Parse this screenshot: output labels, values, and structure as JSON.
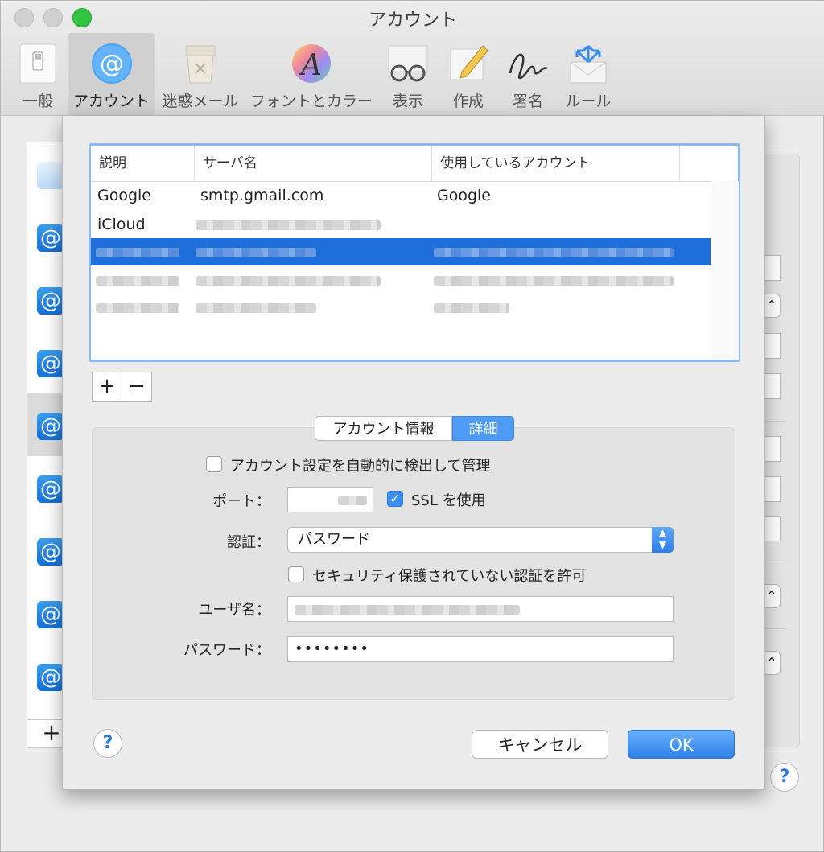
{
  "window": {
    "title": "アカウント"
  },
  "toolbar": {
    "items": [
      {
        "label": "一般",
        "icon": "switch-icon"
      },
      {
        "label": "アカウント",
        "icon": "at-icon",
        "active": true
      },
      {
        "label": "迷惑メール",
        "icon": "junk-icon"
      },
      {
        "label": "フォントとカラー",
        "icon": "font-icon"
      },
      {
        "label": "表示",
        "icon": "glasses-icon"
      },
      {
        "label": "作成",
        "icon": "compose-icon"
      },
      {
        "label": "署名",
        "icon": "signature-icon"
      },
      {
        "label": "ルール",
        "icon": "rules-icon"
      }
    ]
  },
  "table": {
    "headers": [
      "説明",
      "サーバ名",
      "使用しているアカウント"
    ],
    "rows": [
      {
        "description": "Google",
        "server": "smtp.gmail.com",
        "account": "Google"
      },
      {
        "description": "iCloud",
        "server": "",
        "account": ""
      },
      {
        "description": "",
        "server": "",
        "account": ""
      },
      {
        "description": "",
        "server": "",
        "account": ""
      },
      {
        "description": "",
        "server": "",
        "account": ""
      }
    ]
  },
  "controls": {
    "add": "+",
    "remove": "−"
  },
  "tabs": {
    "info": "アカウント情報",
    "detail": "詳細"
  },
  "form": {
    "auto_detect_label": "アカウント設定を自動的に検出して管理",
    "port_label": "ポート：",
    "port_value": "",
    "ssl_label": "SSL を使用",
    "auth_label": "認証：",
    "auth_value": "パスワード",
    "insecure_auth_label": "セキュリティ保護されていない認証を許可",
    "username_label": "ユーザ名：",
    "username_value": "",
    "password_label": "パスワード：",
    "password_value": "••••••••"
  },
  "buttons": {
    "help": "?",
    "cancel": "キャンセル",
    "ok": "OK"
  },
  "colors": {
    "accent": "#2f80ea",
    "selection": "#1e6fd9",
    "focus_ring": "#8fb8ee"
  }
}
